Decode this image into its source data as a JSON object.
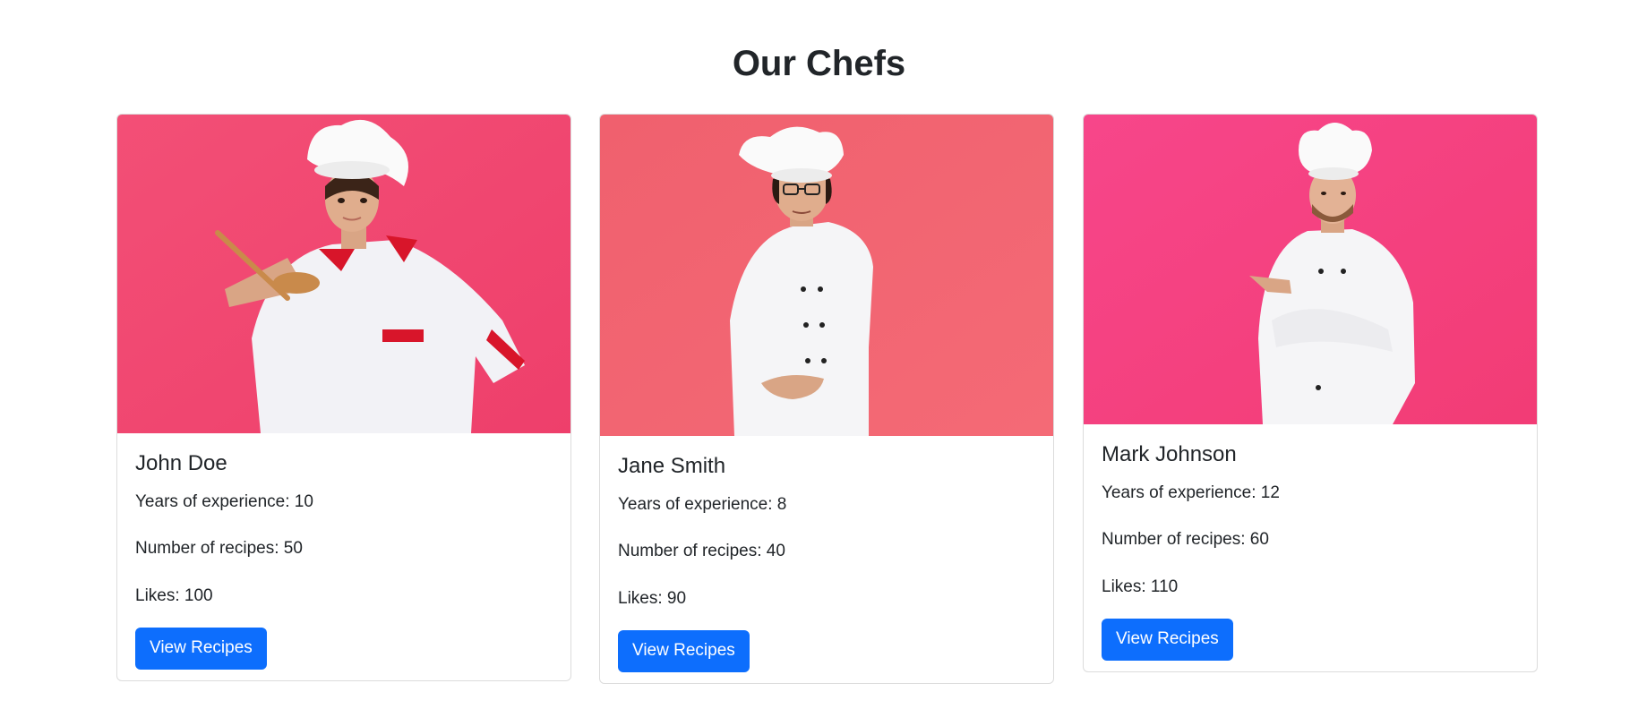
{
  "page": {
    "title": "Our Chefs"
  },
  "chefs": [
    {
      "name": "John Doe",
      "experience": "Years of experience: 10",
      "recipes": "Number of recipes: 50",
      "likes": "Likes: 100",
      "button_label": "View Recipes",
      "image": "chef-photo-woman-with-spoon"
    },
    {
      "name": "Jane Smith",
      "experience": "Years of experience: 8",
      "recipes": "Number of recipes: 40",
      "likes": "Likes: 90",
      "button_label": "View Recipes",
      "image": "chef-photo-man-with-glasses"
    },
    {
      "name": "Mark Johnson",
      "experience": "Years of experience: 12",
      "recipes": "Number of recipes: 60",
      "likes": "Likes: 110",
      "button_label": "View Recipes",
      "image": "chef-photo-man-pointing"
    }
  ],
  "colors": {
    "button": "#0d6efd",
    "photo_background_1": "#f04a72",
    "photo_background_2": "#f25e6e",
    "photo_background_3": "#f5417e"
  }
}
